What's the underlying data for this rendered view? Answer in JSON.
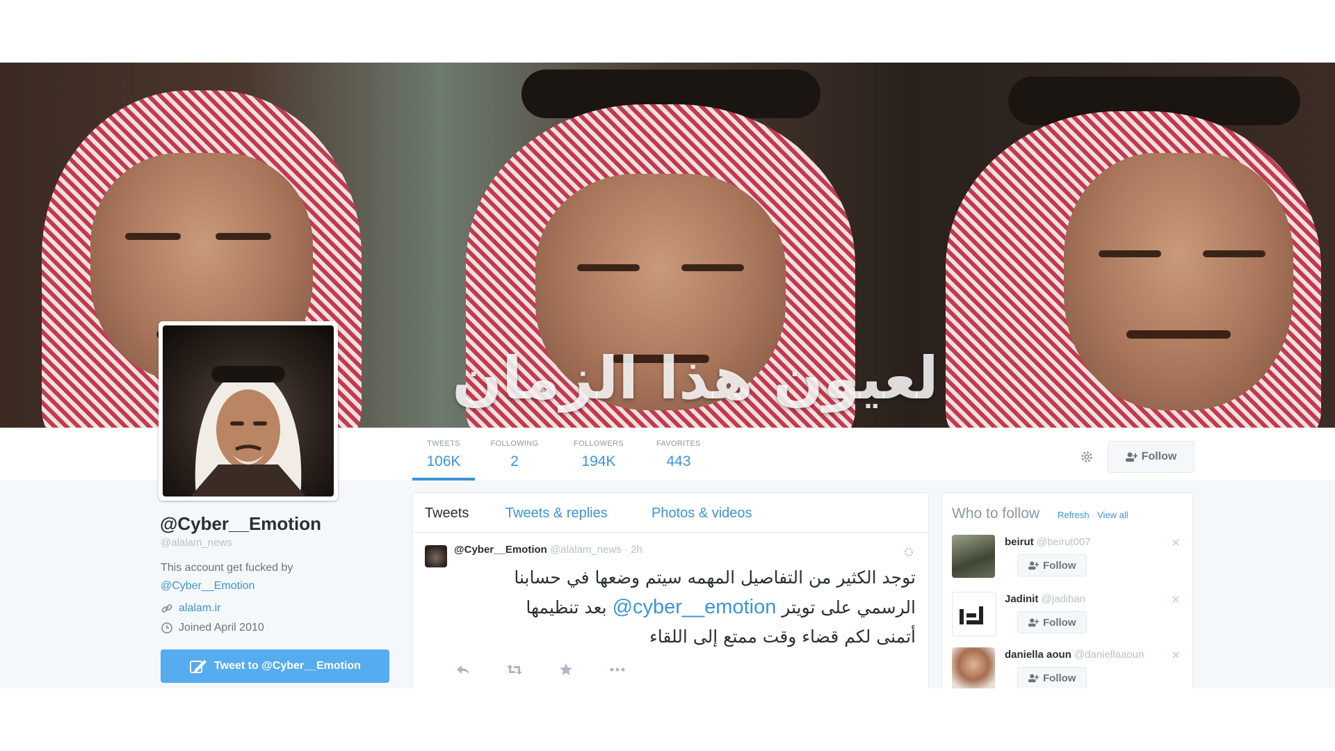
{
  "banner": {
    "caption": "لعيون هذا الزمان"
  },
  "profile": {
    "name": "@Cyber__Emotion",
    "handle": "@alalam_news",
    "bio_text": "This account get fucked by",
    "bio_mention": "@Cyber__Emotion",
    "website": "alalam.ir",
    "joined": "Joined April 2010",
    "tweet_to_label": "Tweet to @Cyber__Emotion"
  },
  "stats": [
    {
      "label": "TWEETS",
      "value": "106K"
    },
    {
      "label": "FOLLOWING",
      "value": "2"
    },
    {
      "label": "FOLLOWERS",
      "value": "194K"
    },
    {
      "label": "FAVORITES",
      "value": "443"
    }
  ],
  "actions": {
    "follow_label": "Follow",
    "gear_icon": "gear-icon"
  },
  "timeline": {
    "tabs": [
      "Tweets",
      "Tweets & replies",
      "Photos & videos"
    ],
    "tweet": {
      "name": "@Cyber__Emotion",
      "handle": "@alalam_news",
      "time": "· 2h",
      "line1": "توجد الكثير من التفاصيل المهمه سيتم وضعها في حسابنا",
      "line2_pre": "الرسمي على تويتر",
      "line2_mention": "@cyber__emotion",
      "line2_post": "بعد تنظيمها",
      "line3": "أتمنى لكم قضاء وقت ممتع إلى اللقاء"
    }
  },
  "who_to_follow": {
    "title": "Who to follow",
    "refresh": "Refresh",
    "separator": "·",
    "view_all": "View all",
    "follow_label": "Follow",
    "items": [
      {
        "name": "beirut",
        "handle": "@beirut007"
      },
      {
        "name": "Jadinit",
        "handle": "@jadiban"
      },
      {
        "name": "daniella aoun",
        "handle": "@daniellaaoun"
      }
    ]
  },
  "colors": {
    "accent": "#55acee",
    "link": "#3b94d9",
    "muted": "#8899a6"
  }
}
